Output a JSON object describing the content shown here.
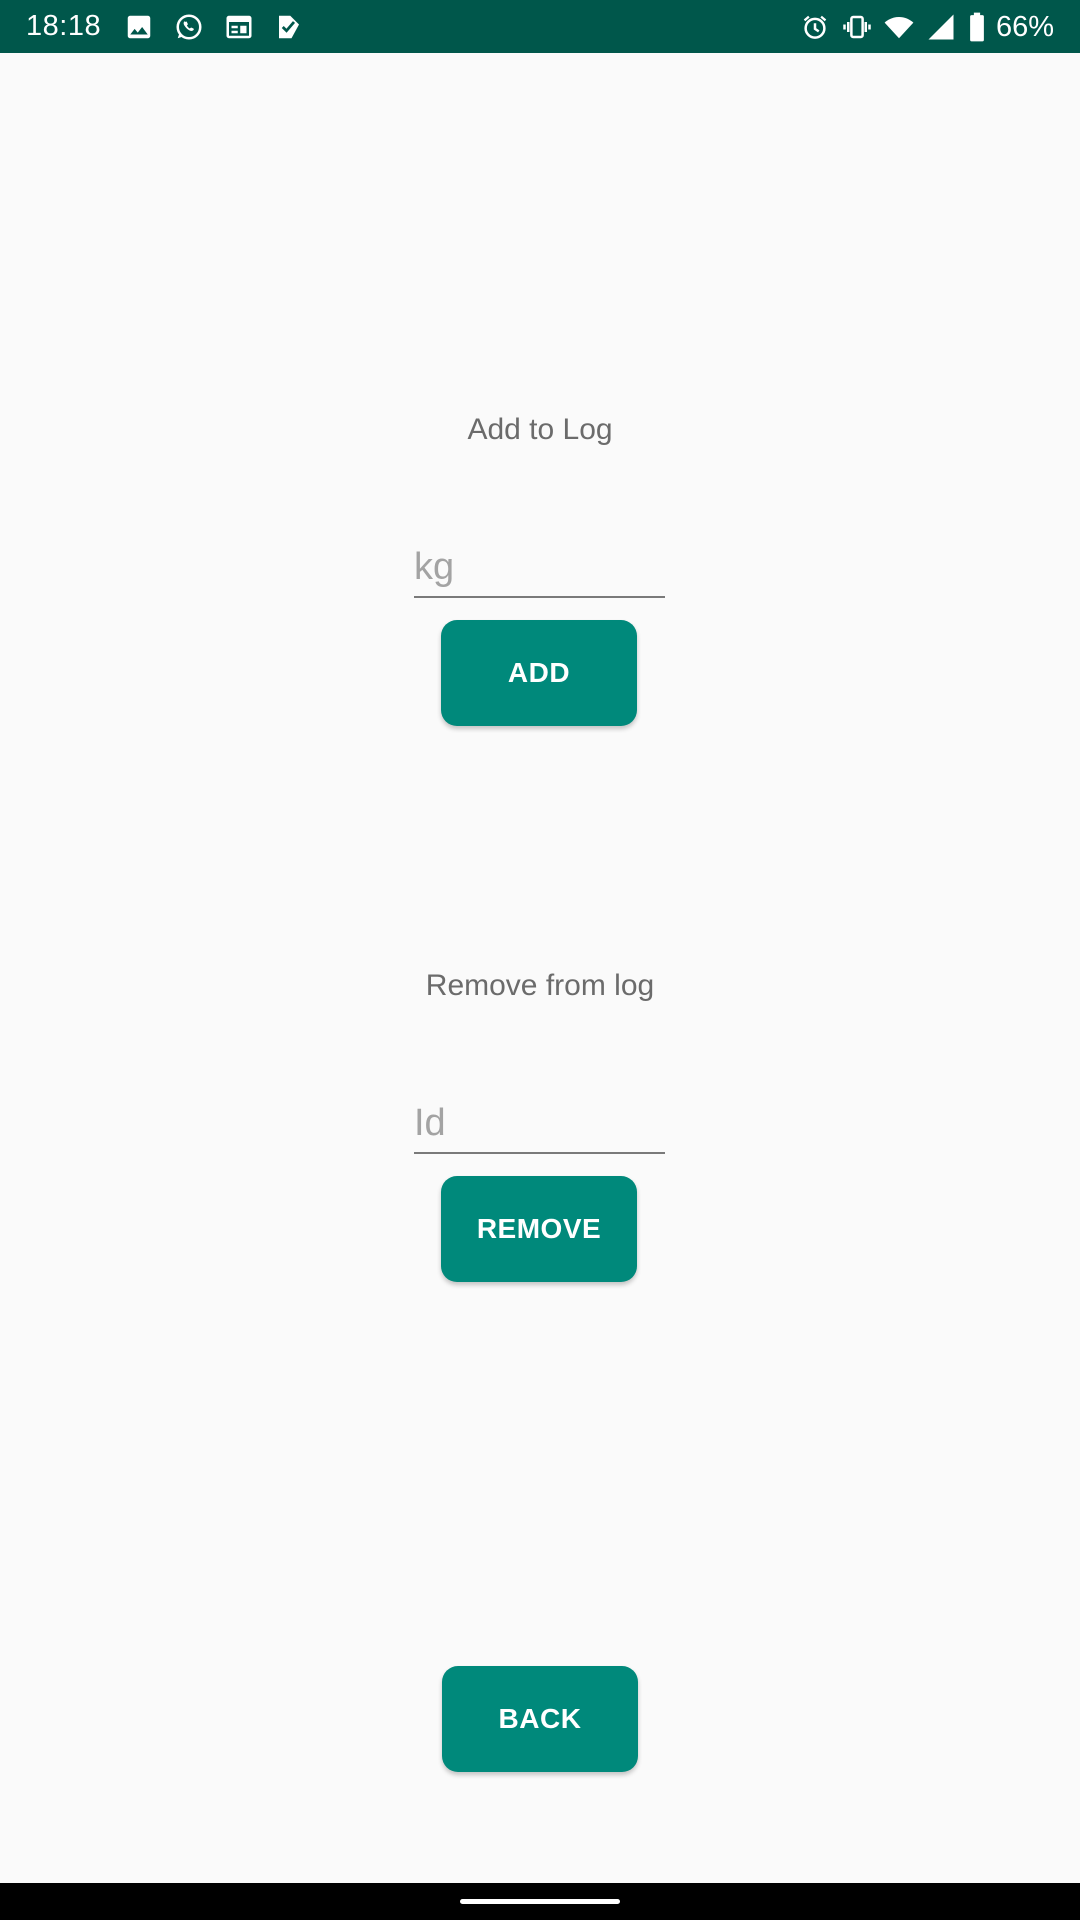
{
  "status_bar": {
    "time": "18:18",
    "left_icons": [
      "image-icon",
      "whatsapp-icon",
      "calendar-icon",
      "checklist-icon"
    ],
    "right_icons": [
      "alarm-icon",
      "vibrate-icon",
      "wifi-icon",
      "signal-icon",
      "battery-icon"
    ],
    "battery_percent": "66%",
    "background_color": "#00574b"
  },
  "add_section": {
    "label": "Add to Log",
    "input_placeholder": "kg",
    "button_label": "ADD"
  },
  "remove_section": {
    "label": "Remove from log",
    "input_placeholder": "Id",
    "button_label": "REMOVE"
  },
  "back_button": {
    "label": "BACK"
  },
  "colors": {
    "accent": "#00897b",
    "background": "#fafafa",
    "label_text": "#6b6b6b"
  }
}
